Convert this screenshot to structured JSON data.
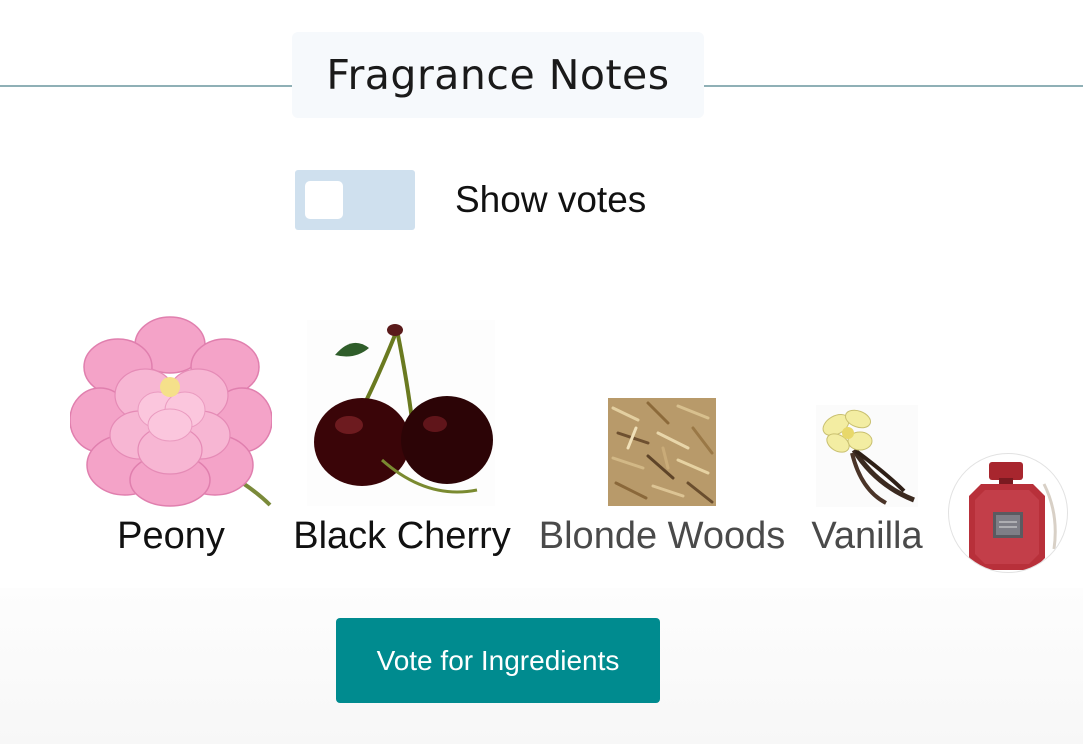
{
  "section": {
    "title": "Fragrance Notes"
  },
  "toggle": {
    "label": "Show votes",
    "on": false
  },
  "notes": [
    {
      "name": "Peony",
      "icon": "peony-flower-image"
    },
    {
      "name": "Black Cherry",
      "icon": "black-cherry-image"
    },
    {
      "name": "Blonde Woods",
      "icon": "wood-shavings-image"
    },
    {
      "name": "Vanilla",
      "icon": "vanilla-flower-image"
    }
  ],
  "product": {
    "icon": "perfume-bottle-image"
  },
  "actions": {
    "vote_label": "Vote for Ingredients"
  },
  "colors": {
    "accent": "#008b8f",
    "rule": "#8fb0b6",
    "toggle_track": "#cfe0ee"
  }
}
